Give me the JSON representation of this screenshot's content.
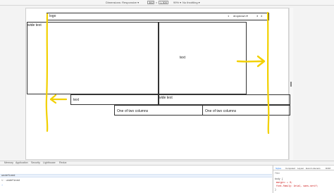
{
  "toolbar": {
    "device": "Dimensions: Responsive ▾",
    "width": "382",
    "height": "1,300",
    "zoom": "99% ▾",
    "throttle": "No throttling ▾"
  },
  "page": {
    "logo": "logo",
    "nav_item_1": "1",
    "dropdown": "dropdown ▾",
    "nav_item_3": "3",
    "nav_item_4": "4",
    "wide_text": "wide text",
    "text": "text",
    "row2_left": "text",
    "row2_right": "wide text",
    "col_a": "One of two columns",
    "col_b": "One of two columns"
  },
  "drawer": {
    "tabs": [
      "Memory",
      "Application",
      "Security",
      "Lighthouse",
      "Redux"
    ]
  },
  "console": {
    "line1": "undefined",
    "line2": "<· undefined"
  },
  "styles_pane": {
    "tabs": [
      "Styles",
      "Computed",
      "Layout",
      "Event Listeners",
      "DOM"
    ],
    "filter": "Filter",
    "rule_selector": "body {",
    "rule_prop1": "margin: ▸ 0;",
    "rule_prop2": "font-family: Arial, sans-serif;",
    "rule_close": "}"
  },
  "colors": {
    "annotation": "#f2d000",
    "viewport_border": "#333333"
  }
}
